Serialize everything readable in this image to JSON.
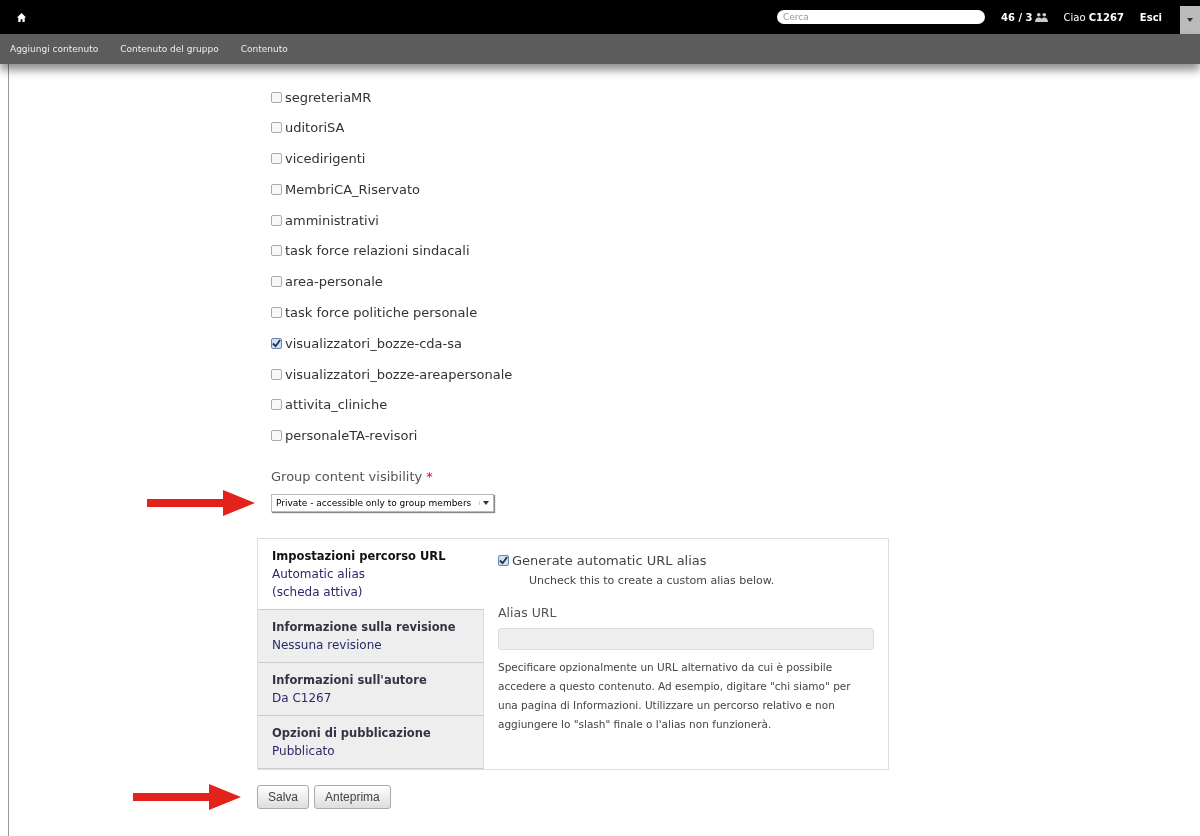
{
  "toolbar": {
    "search": {
      "placeholder": "Cerca"
    },
    "counter": "46 / 3",
    "greeting": "Ciao **C1267**",
    "logout": "Esci"
  },
  "menu": [
    "Aggiungi contenuto",
    "Contenuto del gruppo",
    "Contenuto"
  ],
  "groups": [
    {
      "label": "segreteriaMR",
      "checked": false
    },
    {
      "label": "uditoriSA",
      "checked": false
    },
    {
      "label": "vicedirigenti",
      "checked": false
    },
    {
      "label": "MembriCA_Riservato",
      "checked": false
    },
    {
      "label": "amministrativi",
      "checked": false
    },
    {
      "label": "task force relazioni sindacali",
      "checked": false
    },
    {
      "label": "area-personale",
      "checked": false
    },
    {
      "label": "task force politiche personale",
      "checked": false
    },
    {
      "label": "visualizzatori_bozze-cda-sa",
      "checked": true
    },
    {
      "label": "visualizzatori_bozze-areapersonale",
      "checked": false
    },
    {
      "label": "attivita_cliniche",
      "checked": false
    },
    {
      "label": "personaleTA-revisori",
      "checked": false
    }
  ],
  "visibility": {
    "label": "Group content visibility",
    "required_mark": "*",
    "value": "Private - accessible only to group members"
  },
  "vertical_tabs": [
    {
      "title": "Impostazioni percorso URL",
      "summary": "Automatic alias",
      "note": "(scheda attiva)",
      "selected": true
    },
    {
      "title": "Informazione sulla revisione",
      "summary": "Nessuna revisione",
      "selected": false
    },
    {
      "title": "Informazioni sull'autore",
      "summary": "Da C1267",
      "selected": false
    },
    {
      "title": "Opzioni di pubblicazione",
      "summary": "Pubblicato",
      "selected": false
    }
  ],
  "url_pane": {
    "auto_alias": {
      "label": "Generate automatic URL alias",
      "checked": true,
      "help": "Uncheck this to create a custom alias below."
    },
    "alias_label": "Alias URL",
    "alias_help": "Specificare opzionalmente un URL alternativo da cui è possibile accedere a questo contenuto. Ad esempio, digitare \"chi siamo\" per una pagina di Informazioni. Utilizzare un percorso relativo e non aggiungere lo \"slash\" finale o l'alias non funzionerà."
  },
  "buttons": [
    "Salva",
    "Anteprima"
  ]
}
